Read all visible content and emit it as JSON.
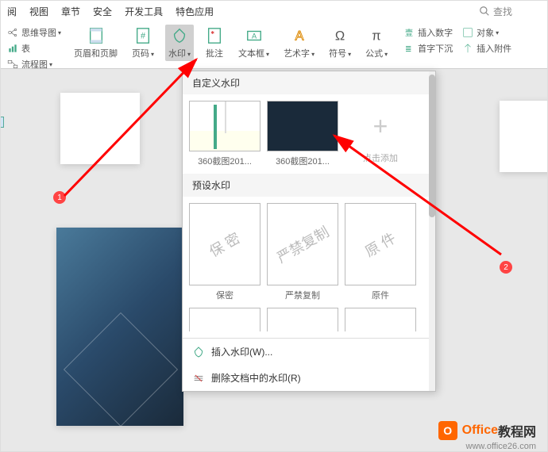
{
  "tabs": {
    "t1": "阅",
    "t2": "视图",
    "t3": "章节",
    "t4": "安全",
    "t5": "开发工具",
    "t6": "特色应用",
    "search": "查找"
  },
  "toolbar": {
    "mindmap": "思维导图",
    "flowchart": "流程图",
    "chart_suffix": "表",
    "header_footer": "页眉和页脚",
    "page_number": "页码",
    "watermark": "水印",
    "comment": "批注",
    "textbox": "文本框",
    "wordart": "艺术字",
    "symbol": "符号",
    "formula": "公式",
    "insert_number": "插入数字",
    "object": "对象",
    "drop_cap": "首字下沉",
    "attachment": "插入附件"
  },
  "popup": {
    "custom_title": "自定义水印",
    "custom1_label": "360截图201...",
    "custom2_label": "360截图201...",
    "add_label": "点击添加",
    "preset_title": "预设水印",
    "preset1": "保 密",
    "preset1_label": "保密",
    "preset2": "严禁复制",
    "preset2_label": "严禁复制",
    "preset3": "原 件",
    "preset3_label": "原件",
    "menu_insert": "插入水印(W)...",
    "menu_remove": "删除文档中的水印(R)"
  },
  "markers": {
    "m1": "1",
    "m2": "2"
  },
  "brand": {
    "text1": "Office",
    "text2": "教程网",
    "url": "www.office26.com"
  }
}
